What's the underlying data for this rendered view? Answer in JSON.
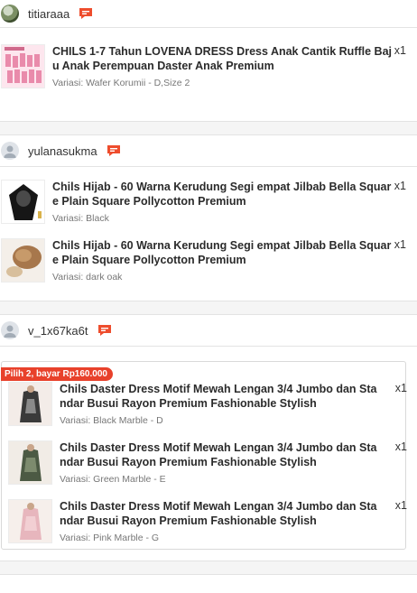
{
  "orders": [
    {
      "buyer": "titiaraaa",
      "items": [
        {
          "title": "CHILS 1-7 Tahun LOVENA DRESS Dress Anak Cantik Ruffle Baju Anak Perempuan Daster Anak Premium",
          "variant": "Variasi: Wafer Korumii - D,Size 2",
          "qty": "x1"
        }
      ]
    },
    {
      "buyer": "yulanasukma",
      "items": [
        {
          "title": "Chils Hijab - 60 Warna Kerudung Segi empat Jilbab Bella Square Plain Square Pollycotton Premium",
          "variant": "Variasi: Black",
          "qty": "x1"
        },
        {
          "title": "Chils Hijab - 60 Warna Kerudung Segi empat Jilbab Bella Square Plain Square Pollycotton Premium",
          "variant": "Variasi: dark oak",
          "qty": "x1"
        }
      ]
    },
    {
      "buyer": "v_1x67ka6t",
      "bundle_label": "Pilih 2, bayar Rp160.000",
      "items": [
        {
          "title": "Chils Daster Dress Motif Mewah Lengan 3/4 Jumbo dan Standar Busui Rayon Premium Fashionable Stylish",
          "variant": "Variasi: Black Marble - D",
          "qty": "x1"
        },
        {
          "title": "Chils Daster Dress Motif Mewah Lengan 3/4 Jumbo dan Standar Busui Rayon Premium Fashionable Stylish",
          "variant": "Variasi: Green Marble - E",
          "qty": "x1"
        },
        {
          "title": "Chils Daster Dress Motif Mewah Lengan 3/4 Jumbo dan Standar Busui Rayon Premium Fashionable Stylish",
          "variant": "Variasi: Pink Marble - G",
          "qty": "x1"
        }
      ]
    }
  ],
  "icons": {
    "chat": "chat-bubble-icon",
    "avatar": "user-avatar-icon"
  },
  "colors": {
    "accent": "#ee4d2d",
    "badge": "#e8412b"
  }
}
